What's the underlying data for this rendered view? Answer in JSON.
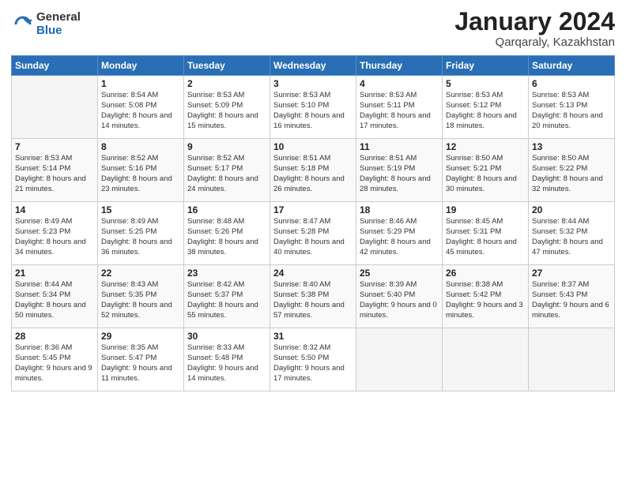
{
  "header": {
    "logo_general": "General",
    "logo_blue": "Blue",
    "month_title": "January 2024",
    "location": "Qarqaraly, Kazakhstan"
  },
  "weekdays": [
    "Sunday",
    "Monday",
    "Tuesday",
    "Wednesday",
    "Thursday",
    "Friday",
    "Saturday"
  ],
  "weeks": [
    [
      {
        "day": "",
        "empty": true
      },
      {
        "day": "1",
        "sunrise": "Sunrise: 8:54 AM",
        "sunset": "Sunset: 5:08 PM",
        "daylight": "Daylight: 8 hours and 14 minutes."
      },
      {
        "day": "2",
        "sunrise": "Sunrise: 8:53 AM",
        "sunset": "Sunset: 5:09 PM",
        "daylight": "Daylight: 8 hours and 15 minutes."
      },
      {
        "day": "3",
        "sunrise": "Sunrise: 8:53 AM",
        "sunset": "Sunset: 5:10 PM",
        "daylight": "Daylight: 8 hours and 16 minutes."
      },
      {
        "day": "4",
        "sunrise": "Sunrise: 8:53 AM",
        "sunset": "Sunset: 5:11 PM",
        "daylight": "Daylight: 8 hours and 17 minutes."
      },
      {
        "day": "5",
        "sunrise": "Sunrise: 8:53 AM",
        "sunset": "Sunset: 5:12 PM",
        "daylight": "Daylight: 8 hours and 18 minutes."
      },
      {
        "day": "6",
        "sunrise": "Sunrise: 8:53 AM",
        "sunset": "Sunset: 5:13 PM",
        "daylight": "Daylight: 8 hours and 20 minutes."
      }
    ],
    [
      {
        "day": "7",
        "sunrise": "Sunrise: 8:53 AM",
        "sunset": "Sunset: 5:14 PM",
        "daylight": "Daylight: 8 hours and 21 minutes."
      },
      {
        "day": "8",
        "sunrise": "Sunrise: 8:52 AM",
        "sunset": "Sunset: 5:16 PM",
        "daylight": "Daylight: 8 hours and 23 minutes."
      },
      {
        "day": "9",
        "sunrise": "Sunrise: 8:52 AM",
        "sunset": "Sunset: 5:17 PM",
        "daylight": "Daylight: 8 hours and 24 minutes."
      },
      {
        "day": "10",
        "sunrise": "Sunrise: 8:51 AM",
        "sunset": "Sunset: 5:18 PM",
        "daylight": "Daylight: 8 hours and 26 minutes."
      },
      {
        "day": "11",
        "sunrise": "Sunrise: 8:51 AM",
        "sunset": "Sunset: 5:19 PM",
        "daylight": "Daylight: 8 hours and 28 minutes."
      },
      {
        "day": "12",
        "sunrise": "Sunrise: 8:50 AM",
        "sunset": "Sunset: 5:21 PM",
        "daylight": "Daylight: 8 hours and 30 minutes."
      },
      {
        "day": "13",
        "sunrise": "Sunrise: 8:50 AM",
        "sunset": "Sunset: 5:22 PM",
        "daylight": "Daylight: 8 hours and 32 minutes."
      }
    ],
    [
      {
        "day": "14",
        "sunrise": "Sunrise: 8:49 AM",
        "sunset": "Sunset: 5:23 PM",
        "daylight": "Daylight: 8 hours and 34 minutes."
      },
      {
        "day": "15",
        "sunrise": "Sunrise: 8:49 AM",
        "sunset": "Sunset: 5:25 PM",
        "daylight": "Daylight: 8 hours and 36 minutes."
      },
      {
        "day": "16",
        "sunrise": "Sunrise: 8:48 AM",
        "sunset": "Sunset: 5:26 PM",
        "daylight": "Daylight: 8 hours and 38 minutes."
      },
      {
        "day": "17",
        "sunrise": "Sunrise: 8:47 AM",
        "sunset": "Sunset: 5:28 PM",
        "daylight": "Daylight: 8 hours and 40 minutes."
      },
      {
        "day": "18",
        "sunrise": "Sunrise: 8:46 AM",
        "sunset": "Sunset: 5:29 PM",
        "daylight": "Daylight: 8 hours and 42 minutes."
      },
      {
        "day": "19",
        "sunrise": "Sunrise: 8:45 AM",
        "sunset": "Sunset: 5:31 PM",
        "daylight": "Daylight: 8 hours and 45 minutes."
      },
      {
        "day": "20",
        "sunrise": "Sunrise: 8:44 AM",
        "sunset": "Sunset: 5:32 PM",
        "daylight": "Daylight: 8 hours and 47 minutes."
      }
    ],
    [
      {
        "day": "21",
        "sunrise": "Sunrise: 8:44 AM",
        "sunset": "Sunset: 5:34 PM",
        "daylight": "Daylight: 8 hours and 50 minutes."
      },
      {
        "day": "22",
        "sunrise": "Sunrise: 8:43 AM",
        "sunset": "Sunset: 5:35 PM",
        "daylight": "Daylight: 8 hours and 52 minutes."
      },
      {
        "day": "23",
        "sunrise": "Sunrise: 8:42 AM",
        "sunset": "Sunset: 5:37 PM",
        "daylight": "Daylight: 8 hours and 55 minutes."
      },
      {
        "day": "24",
        "sunrise": "Sunrise: 8:40 AM",
        "sunset": "Sunset: 5:38 PM",
        "daylight": "Daylight: 8 hours and 57 minutes."
      },
      {
        "day": "25",
        "sunrise": "Sunrise: 8:39 AM",
        "sunset": "Sunset: 5:40 PM",
        "daylight": "Daylight: 9 hours and 0 minutes."
      },
      {
        "day": "26",
        "sunrise": "Sunrise: 8:38 AM",
        "sunset": "Sunset: 5:42 PM",
        "daylight": "Daylight: 9 hours and 3 minutes."
      },
      {
        "day": "27",
        "sunrise": "Sunrise: 8:37 AM",
        "sunset": "Sunset: 5:43 PM",
        "daylight": "Daylight: 9 hours and 6 minutes."
      }
    ],
    [
      {
        "day": "28",
        "sunrise": "Sunrise: 8:36 AM",
        "sunset": "Sunset: 5:45 PM",
        "daylight": "Daylight: 9 hours and 9 minutes."
      },
      {
        "day": "29",
        "sunrise": "Sunrise: 8:35 AM",
        "sunset": "Sunset: 5:47 PM",
        "daylight": "Daylight: 9 hours and 11 minutes."
      },
      {
        "day": "30",
        "sunrise": "Sunrise: 8:33 AM",
        "sunset": "Sunset: 5:48 PM",
        "daylight": "Daylight: 9 hours and 14 minutes."
      },
      {
        "day": "31",
        "sunrise": "Sunrise: 8:32 AM",
        "sunset": "Sunset: 5:50 PM",
        "daylight": "Daylight: 9 hours and 17 minutes."
      },
      {
        "day": "",
        "empty": true
      },
      {
        "day": "",
        "empty": true
      },
      {
        "day": "",
        "empty": true
      }
    ]
  ]
}
